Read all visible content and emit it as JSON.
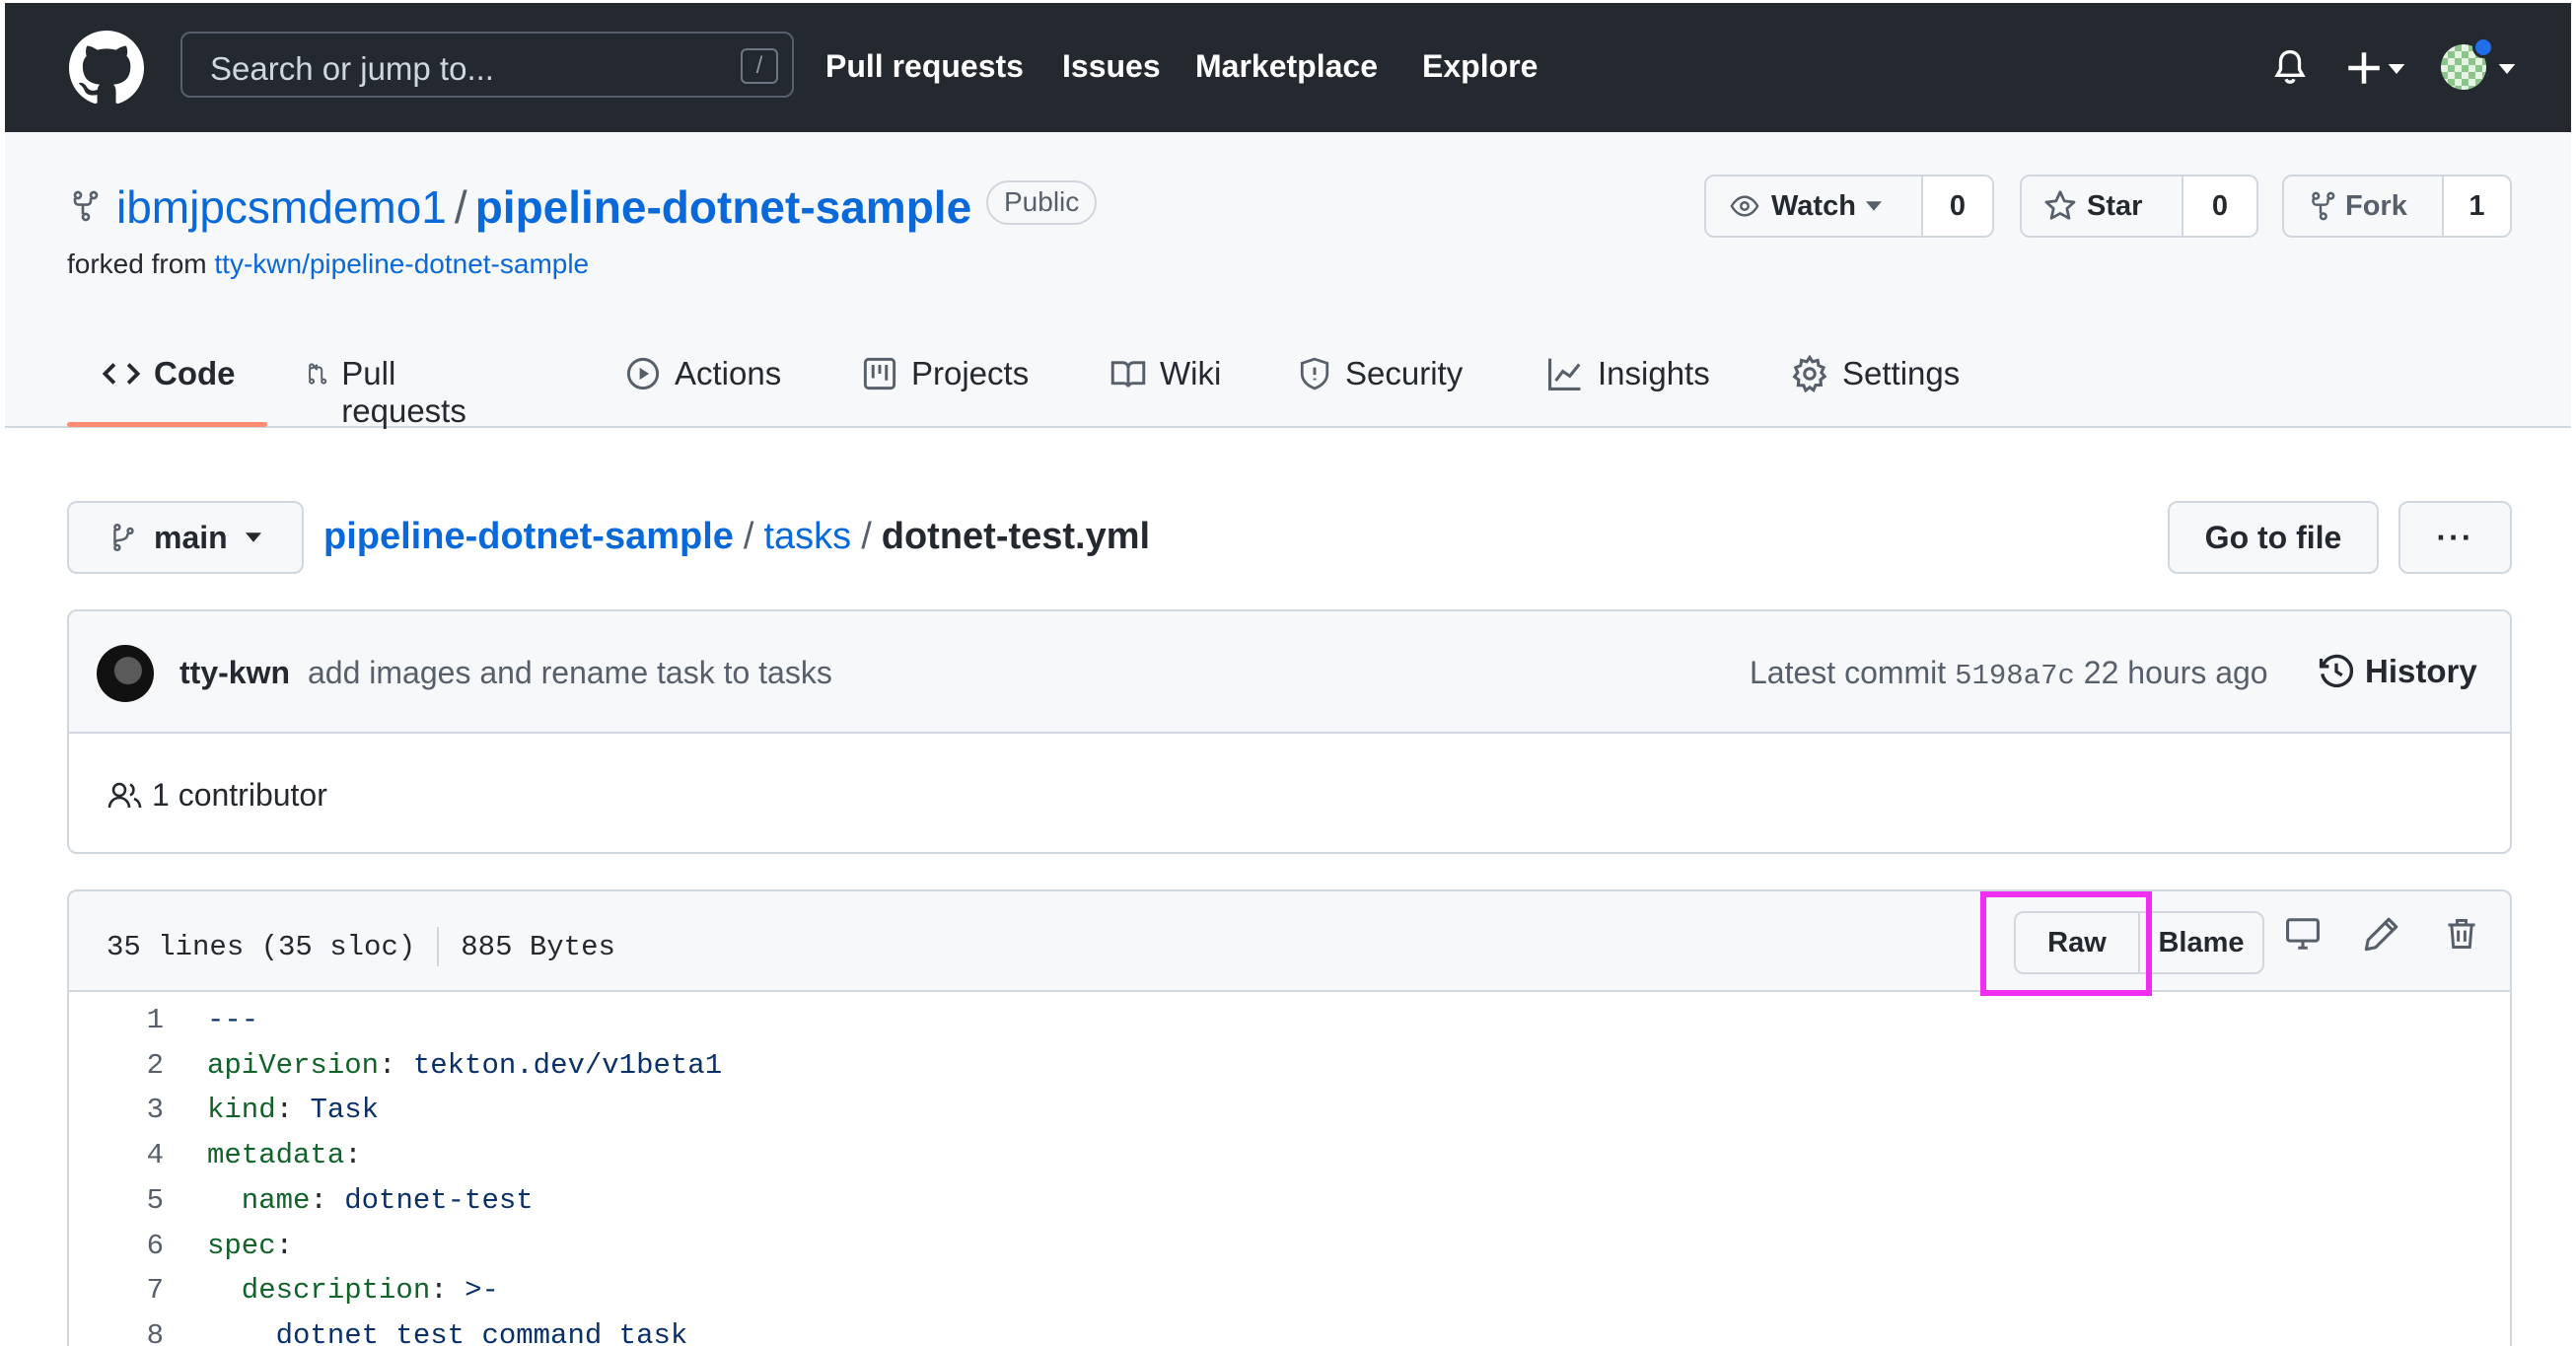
{
  "header": {
    "search_placeholder": "Search or jump to...",
    "search_shortcut": "/",
    "nav": [
      "Pull requests",
      "Issues",
      "Marketplace",
      "Explore"
    ]
  },
  "repo": {
    "owner": "ibmjpcsmdemo1",
    "separator": "/",
    "name": "pipeline-dotnet-sample",
    "visibility": "Public",
    "forked_prefix": "forked from",
    "forked_source": "tty-kwn/pipeline-dotnet-sample",
    "watch_label": "Watch",
    "watch_count": "0",
    "star_label": "Star",
    "star_count": "0",
    "fork_label": "Fork",
    "fork_count": "1"
  },
  "tabs": [
    {
      "label": "Code",
      "icon": "code-icon"
    },
    {
      "label": "Pull requests",
      "icon": "git-pull-request-icon"
    },
    {
      "label": "Actions",
      "icon": "play-icon"
    },
    {
      "label": "Projects",
      "icon": "table-icon"
    },
    {
      "label": "Wiki",
      "icon": "book-icon"
    },
    {
      "label": "Security",
      "icon": "shield-icon"
    },
    {
      "label": "Insights",
      "icon": "graph-icon"
    },
    {
      "label": "Settings",
      "icon": "gear-icon"
    }
  ],
  "filenav": {
    "branch": "main",
    "crumbs": [
      "pipeline-dotnet-sample",
      "tasks"
    ],
    "sep": "/",
    "current_file": "dotnet-test.yml",
    "go_to_file": "Go to file",
    "more": "···"
  },
  "commit": {
    "author": "tty-kwn",
    "message": "add images and rename task to tasks",
    "latest_label": "Latest commit",
    "sha": "5198a7c",
    "time": "22 hours ago",
    "history": "History",
    "contributors": "1 contributor"
  },
  "file": {
    "lines_info": "35 lines (35 sloc)",
    "size": "885 Bytes",
    "raw": "Raw",
    "blame": "Blame",
    "code": [
      {
        "n": "1",
        "key": "",
        "sep": "",
        "val": "---"
      },
      {
        "n": "2",
        "key": "apiVersion",
        "sep": ": ",
        "val": "tekton.dev/v1beta1"
      },
      {
        "n": "3",
        "key": "kind",
        "sep": ": ",
        "val": "Task"
      },
      {
        "n": "4",
        "key": "metadata",
        "sep": ":",
        "val": ""
      },
      {
        "n": "5",
        "key": "  name",
        "sep": ": ",
        "val": "dotnet-test"
      },
      {
        "n": "6",
        "key": "spec",
        "sep": ":",
        "val": ""
      },
      {
        "n": "7",
        "key": "  description",
        "sep": ": ",
        "val": ">-"
      },
      {
        "n": "8",
        "key": "",
        "sep": "",
        "val": "    dotnet test command task"
      }
    ]
  },
  "colors": {
    "header_bg": "#24292f",
    "link": "#0969da",
    "tab_underline": "#fd8c73",
    "highlight": "#f02ef0"
  }
}
